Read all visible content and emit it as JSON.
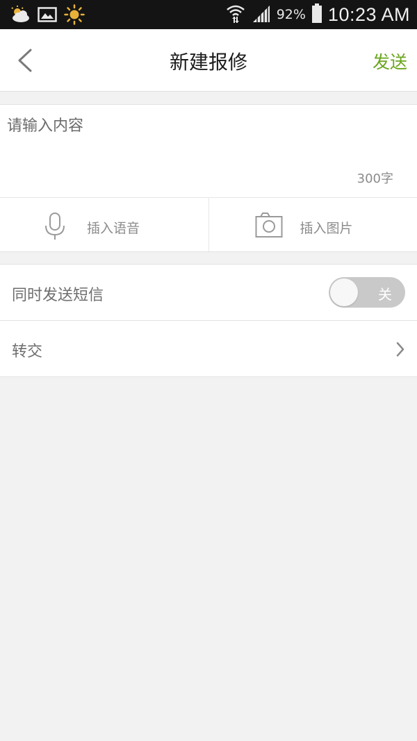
{
  "status_bar": {
    "battery": "92%",
    "time": "10:23 AM"
  },
  "header": {
    "title": "新建报修",
    "send_label": "发送"
  },
  "content": {
    "placeholder": "请输入内容",
    "char_count": "300字"
  },
  "insert": {
    "voice_label": "插入语音",
    "image_label": "插入图片"
  },
  "options": {
    "sms_label": "同时发送短信",
    "sms_toggle_text": "关",
    "transfer_label": "转交"
  },
  "colors": {
    "accent": "#6aa51e",
    "background": "#f2f2f2",
    "toggle_off": "#c9c9c9"
  }
}
